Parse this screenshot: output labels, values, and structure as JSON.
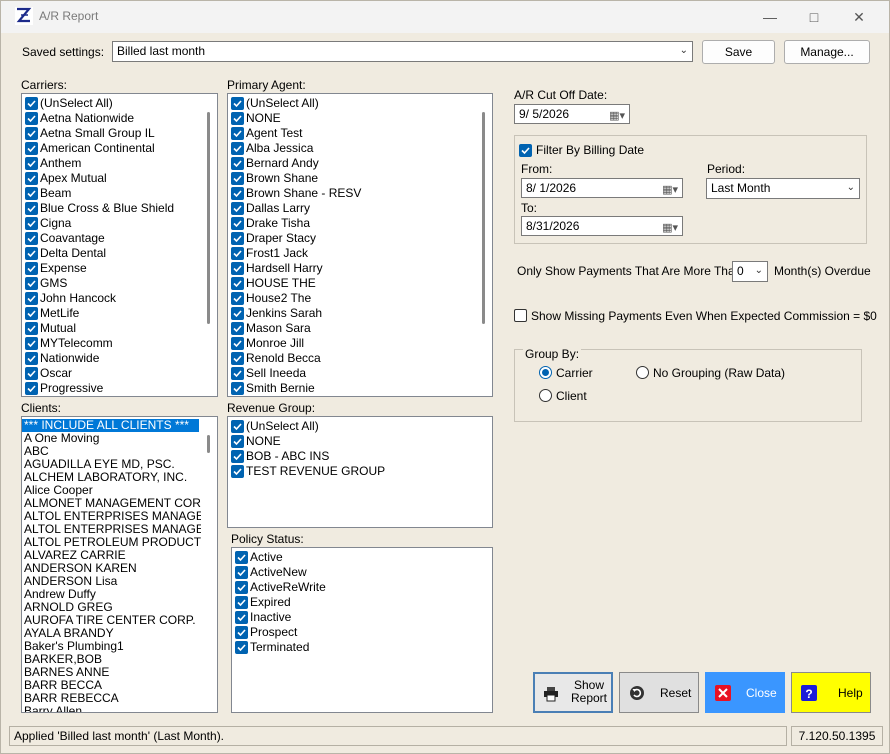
{
  "window": {
    "title": "A/R Report"
  },
  "saved_settings": {
    "label": "Saved settings:",
    "value": "Billed last month",
    "save_label": "Save",
    "manage_label": "Manage..."
  },
  "carriers": {
    "label": "Carriers:",
    "items": [
      "(UnSelect All)",
      "Aetna Nationwide",
      "Aetna Small Group IL",
      "American Continental",
      "Anthem",
      "Apex Mutual",
      "Beam",
      "Blue Cross & Blue Shield",
      "Cigna",
      "Coavantage",
      "Delta Dental",
      "Expense",
      "GMS",
      "John Hancock",
      "MetLife",
      "Mutual",
      "MYTelecomm",
      "Nationwide",
      "Oscar",
      "Progressive"
    ]
  },
  "primary_agent": {
    "label": "Primary Agent:",
    "items": [
      "(UnSelect All)",
      "NONE",
      "Agent Test",
      "Alba Jessica",
      "Bernard Andy",
      "Brown Shane",
      "Brown Shane - RESV",
      "Dallas Larry",
      "Drake Tisha",
      "Draper Stacy",
      "Frost1 Jack",
      "Hardsell Harry",
      "HOUSE THE",
      "House2 The",
      "Jenkins Sarah",
      "Mason Sara",
      "Monroe Jill",
      "Renold Becca",
      "Sell Ineeda",
      "Smith Bernie"
    ]
  },
  "clients": {
    "label": "Clients:",
    "items": [
      "*** INCLUDE ALL CLIENTS ***",
      "A One Moving",
      "ABC",
      "AGUADILLA EYE MD, PSC.",
      "ALCHEM LABORATORY, INC.",
      "Alice Cooper",
      "ALMONET MANAGEMENT CORPO",
      "ALTOL ENTERPRISES MANAGEME",
      "ALTOL ENTERPRISES MANAGEME",
      "ALTOL PETROLEUM PRODUCTS",
      "ALVAREZ CARRIE",
      "ANDERSON KAREN",
      "ANDERSON Lisa",
      "Andrew Duffy",
      "ARNOLD GREG",
      "AUROFA TIRE CENTER CORP.",
      "AYALA BRANDY",
      "Baker's Plumbing1",
      "BARKER,BOB",
      "BARNES ANNE",
      "BARR BECCA",
      "BARR REBECCA",
      "Barry Allen"
    ]
  },
  "revenue_group": {
    "label": "Revenue Group:",
    "items": [
      "(UnSelect All)",
      "NONE",
      "BOB - ABC INS",
      "TEST REVENUE GROUP"
    ]
  },
  "policy_status": {
    "label": "Policy Status:",
    "items": [
      "Active",
      "ActiveNew",
      "ActiveReWrite",
      "Expired",
      "Inactive",
      "Prospect",
      "Terminated"
    ]
  },
  "cutoff": {
    "label": "A/R Cut Off Date:",
    "value": "9/  5/2026"
  },
  "billing_filter": {
    "label": "Filter By Billing Date",
    "from_label": "From:",
    "from_value": "8/  1/2026",
    "to_label": "To:",
    "to_value": "8/31/2026",
    "period_label": "Period:",
    "period_value": "Last Month"
  },
  "overdue": {
    "prefix": "Only Show Payments That Are More Than",
    "value": "0",
    "suffix": "Month(s) Overdue"
  },
  "missing_payments": {
    "label": "Show Missing Payments Even When Expected Commission = $0"
  },
  "group_by": {
    "label": "Group By:",
    "carrier": "Carrier",
    "no_grouping": "No Grouping (Raw Data)",
    "client": "Client"
  },
  "buttons": {
    "show_report": "Show Report",
    "reset": "Reset",
    "close": "Close",
    "help": "Help"
  },
  "status": {
    "message": "Applied 'Billed last month' (Last Month).",
    "version": "7.120.50.1395"
  },
  "colors": {
    "close_bg": "#3a96ff",
    "help_bg": "#ffff00",
    "check_blue": "#0063b1",
    "selection": "#0078d7"
  }
}
